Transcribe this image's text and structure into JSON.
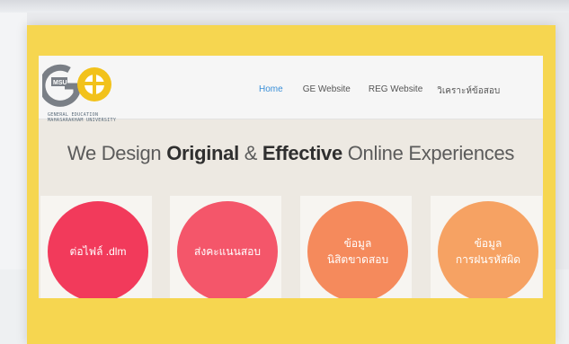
{
  "logo": {
    "letters": "GE",
    "badge": "MSU",
    "caption_line1": "GENERAL EDUCATION",
    "caption_line2": "MAHASARAKHAM UNIVERSITY"
  },
  "nav": {
    "items": [
      {
        "label": "Home",
        "active": true
      },
      {
        "label": "GE Website"
      },
      {
        "label": "REG Website"
      },
      {
        "label": "วิเคราะห์ข้อสอบ"
      }
    ]
  },
  "headline": {
    "part1": "We Design ",
    "part2": "Original",
    "part3": " & ",
    "part4": "Effective",
    "part5": " Online Experiences"
  },
  "tiles": [
    {
      "line1": "ต่อไฟล์ .dlm",
      "line2": "",
      "color": "#f23a5b"
    },
    {
      "line1": "ส่งคะแนนสอบ",
      "line2": "",
      "color": "#f4566a"
    },
    {
      "line1": "ข้อมูล",
      "line2": "นิสิตขาดสอบ",
      "color": "#f58a5c"
    },
    {
      "line1": "ข้อมูล",
      "line2": "การฝนรหัสผิด",
      "color": "#f6a263"
    }
  ],
  "colors": {
    "frame": "#f6d650",
    "site_bg": "#ede9e2",
    "nav_active": "#3a8fd8"
  }
}
